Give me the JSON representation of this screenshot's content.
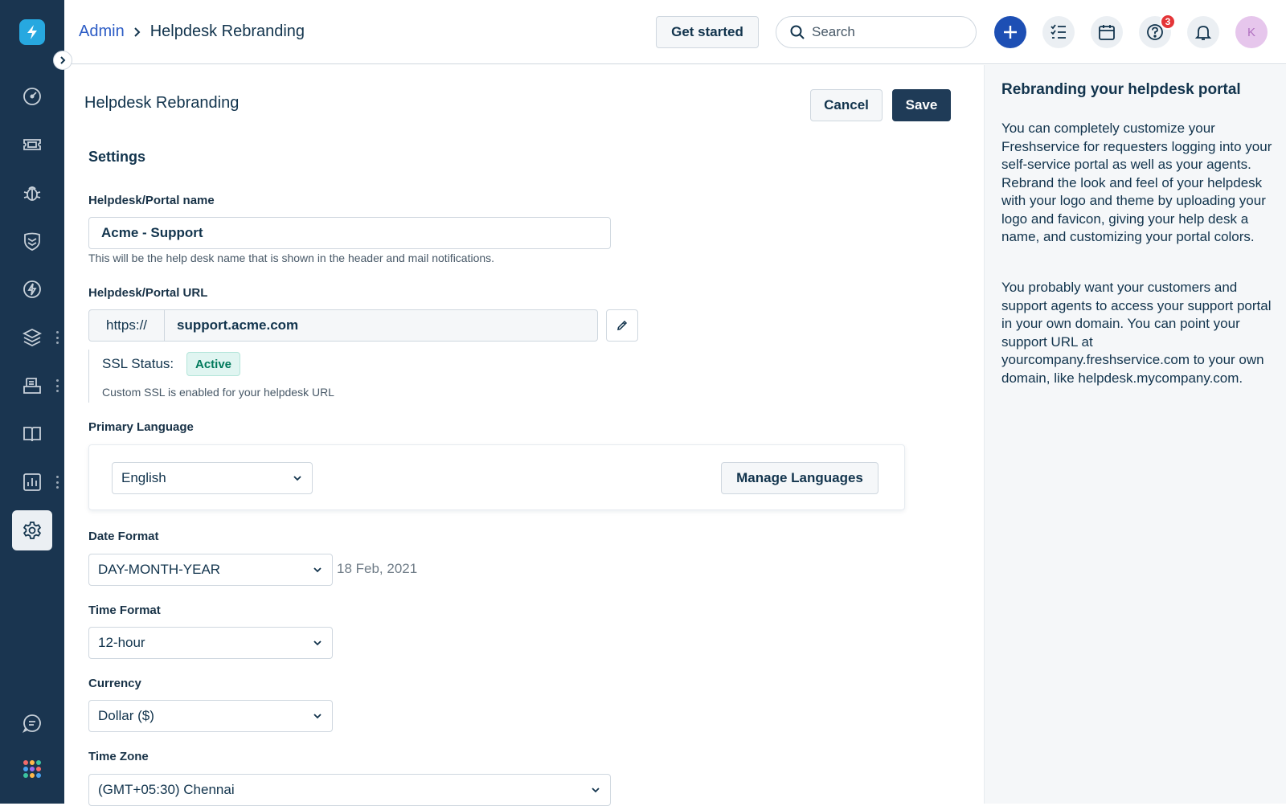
{
  "header": {
    "breadcrumb_root": "Admin",
    "breadcrumb_current": "Helpdesk Rebranding",
    "get_started_label": "Get started",
    "search_placeholder": "Search",
    "notification_count": "3",
    "avatar_initial": "K"
  },
  "sidebar": {
    "items": [
      "dashboard",
      "tickets",
      "problems",
      "changes",
      "releases",
      "assets",
      "purchase-orders",
      "solutions",
      "analytics",
      "admin"
    ],
    "active": "admin"
  },
  "page": {
    "title": "Helpdesk Rebranding",
    "cancel_label": "Cancel",
    "save_label": "Save",
    "section_title": "Settings"
  },
  "form": {
    "portal_name_label": "Helpdesk/Portal name",
    "portal_name_value": "Acme - Support",
    "portal_name_hint": "This will be the help desk name that is shown in the header and mail notifications.",
    "portal_url_label": "Helpdesk/Portal URL",
    "portal_url_prefix": "https://",
    "portal_url_value": "support.acme.com",
    "ssl_label": "SSL Status:",
    "ssl_status": "Active",
    "ssl_note": "Custom SSL is enabled for your helpdesk URL",
    "primary_language_label": "Primary Language",
    "primary_language_value": "English",
    "manage_languages_label": "Manage Languages",
    "date_format_label": "Date Format",
    "date_format_value": "DAY-MONTH-YEAR",
    "date_format_preview": "18 Feb, 2021",
    "time_format_label": "Time Format",
    "time_format_value": "12-hour",
    "currency_label": "Currency",
    "currency_value": "Dollar ($)",
    "time_zone_label": "Time Zone",
    "time_zone_value": "(GMT+05:30) Chennai"
  },
  "help": {
    "title": "Rebranding your helpdesk portal",
    "paragraph_1": "You can completely customize your Freshservice for requesters logging into your self-service portal as well as your agents. Rebrand the look and feel of your helpdesk with your logo and theme by uploading your logo and favicon, giving your help desk a name, and customizing your portal colors.",
    "paragraph_2": "You probably want your customers and support agents to access your support portal in your own domain. You can point your support URL at yourcompany.freshservice.com to your own domain, like helpdesk.mycompany.com."
  },
  "colors": {
    "sidebar_bg": "#1a3550",
    "primary_button": "#1f3b57",
    "accent_blue": "#2c5cc5",
    "success_text": "#00795b",
    "alert_red": "#e43538"
  }
}
